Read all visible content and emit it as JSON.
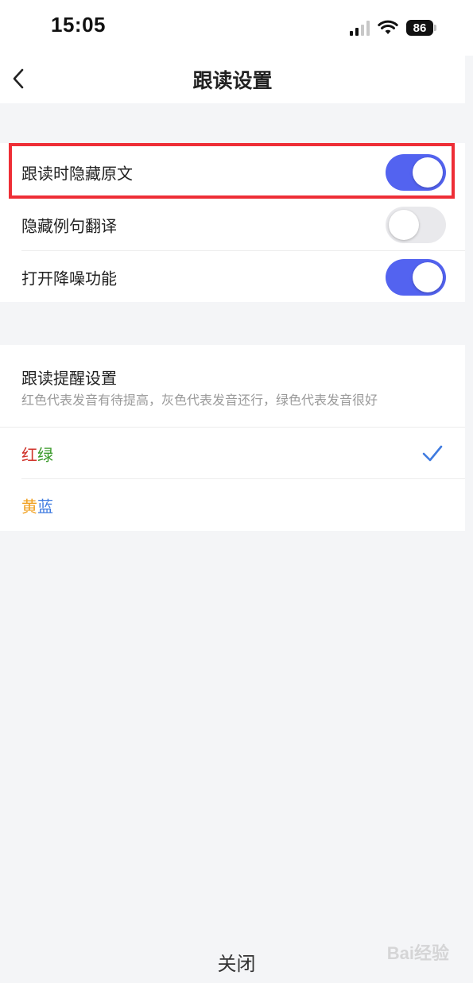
{
  "status_bar": {
    "time": "15:05",
    "battery": "86"
  },
  "nav": {
    "title": "跟读设置"
  },
  "toggles": [
    {
      "label": "跟读时隐藏原文",
      "on": true
    },
    {
      "label": "隐藏例句翻译",
      "on": false
    },
    {
      "label": "打开降噪功能",
      "on": true
    }
  ],
  "reminder": {
    "title": "跟读提醒设置",
    "subtitle": "红色代表发音有待提高，灰色代表发音还行，绿色代表发音很好",
    "options": [
      {
        "parts": [
          {
            "text": "红",
            "color": "#d0342c"
          },
          {
            "text": "绿",
            "color": "#3a9a2a"
          }
        ],
        "selected": true
      },
      {
        "parts": [
          {
            "text": "黄",
            "color": "#f0a020"
          },
          {
            "text": "蓝",
            "color": "#3f7be0"
          }
        ],
        "selected": false
      }
    ]
  },
  "footer": {
    "close_label": "关闭"
  },
  "watermark": {
    "text": "Bai经验"
  },
  "colors": {
    "accent": "#5363f0",
    "check": "#3f7be0",
    "highlight": "#ee2e36"
  }
}
